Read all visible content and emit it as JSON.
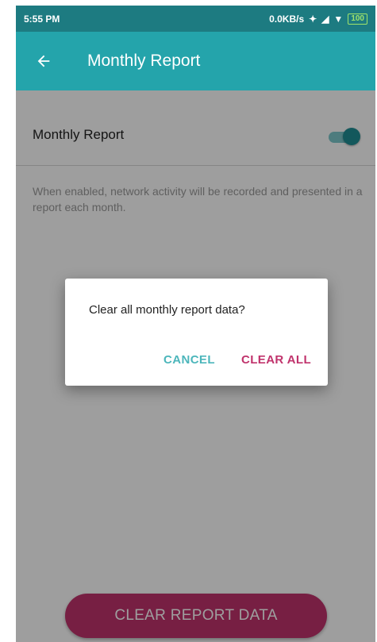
{
  "status_bar": {
    "time": "5:55 PM",
    "network_speed": "0.0KB/s",
    "battery": "100"
  },
  "app_bar": {
    "title": "Monthly Report",
    "back_icon": "arrow-left"
  },
  "setting": {
    "label": "Monthly Report",
    "toggle_state": "on",
    "description": "When enabled, network activity will be recorded and presented in a report each month."
  },
  "dialog": {
    "message": "Clear all monthly report data?",
    "cancel_label": "CANCEL",
    "clear_all_label": "CLEAR ALL"
  },
  "footer": {
    "clear_report_label": "CLEAR REPORT DATA"
  },
  "colors": {
    "appbar": "#24a4ab",
    "statusbar": "#1d7b81",
    "accent": "#c0336c",
    "toggle_on": "#1f8f95"
  }
}
